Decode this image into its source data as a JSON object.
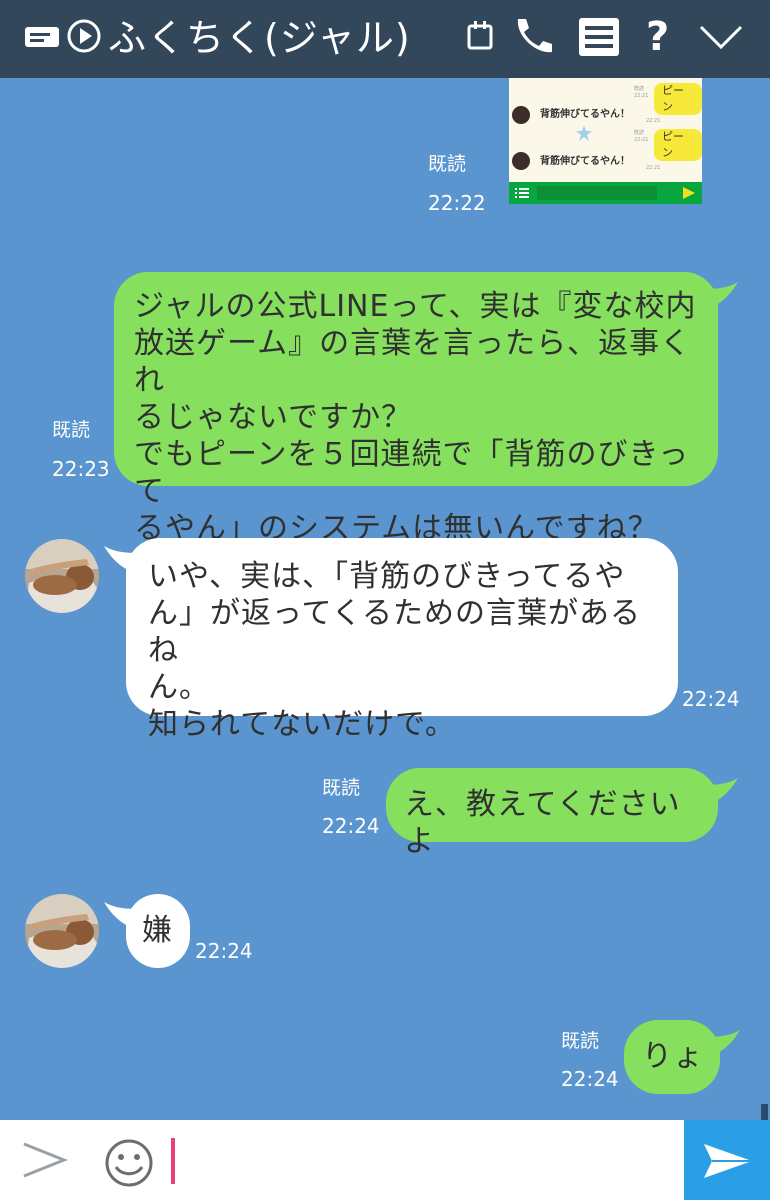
{
  "header": {
    "title": "ふくちく(ジャル)",
    "icons": [
      "keyboard-icon",
      "play-icon",
      "calendar-icon",
      "phone-icon",
      "menu-icon",
      "help-icon",
      "chevron-down-icon"
    ],
    "help_glyph": "?"
  },
  "colors": {
    "header_bg": "#33475b",
    "chat_bg": "#5a95cf",
    "my_bubble": "#86e05e",
    "other_bubble": "#ffffff",
    "send_button": "#2b9fe6",
    "caret": "#e8417e"
  },
  "thumbnail": {
    "pill_1": "ピーン",
    "pill_2": "ピーン",
    "message_1": "背筋伸びてるやん！",
    "message_2": "背筋伸びてるやん！",
    "tiny_label_1": "既読",
    "tiny_time_1": "22:21",
    "tiny_time_2": "22:21",
    "tiny_label_2": "既読",
    "tiny_time_3": "22:21",
    "tiny_time_4": "22:21"
  },
  "messages": [
    {
      "sender": "me",
      "type": "image",
      "read": "既読",
      "time": "22:22"
    },
    {
      "sender": "me",
      "read": "既読",
      "time": "22:23",
      "lines": [
        "ジャルの公式LINEって、実は『変な校内",
        "放送ゲーム』の言葉を言ったら、返事くれ",
        "るじゃないですか？",
        "でもピーンを５回連続で「背筋のびきって",
        "るやん」のシステムは無いんですね？"
      ]
    },
    {
      "sender": "other",
      "time": "22:24",
      "lines": [
        "いや、実は、「背筋のびきってるや",
        "ん」が返ってくるための言葉があるね",
        "ん。",
        "知られてないだけで。"
      ]
    },
    {
      "sender": "me",
      "read": "既読",
      "time": "22:24",
      "lines": [
        "え、教えてくださいよ"
      ]
    },
    {
      "sender": "other",
      "time": "22:24",
      "lines": [
        "嫌"
      ]
    },
    {
      "sender": "me",
      "read": "既読",
      "time": "22:24",
      "lines": [
        "りょ"
      ]
    }
  ],
  "input": {
    "value": "",
    "icons": [
      "expand-chevron-icon",
      "emoji-icon",
      "send-icon"
    ]
  }
}
